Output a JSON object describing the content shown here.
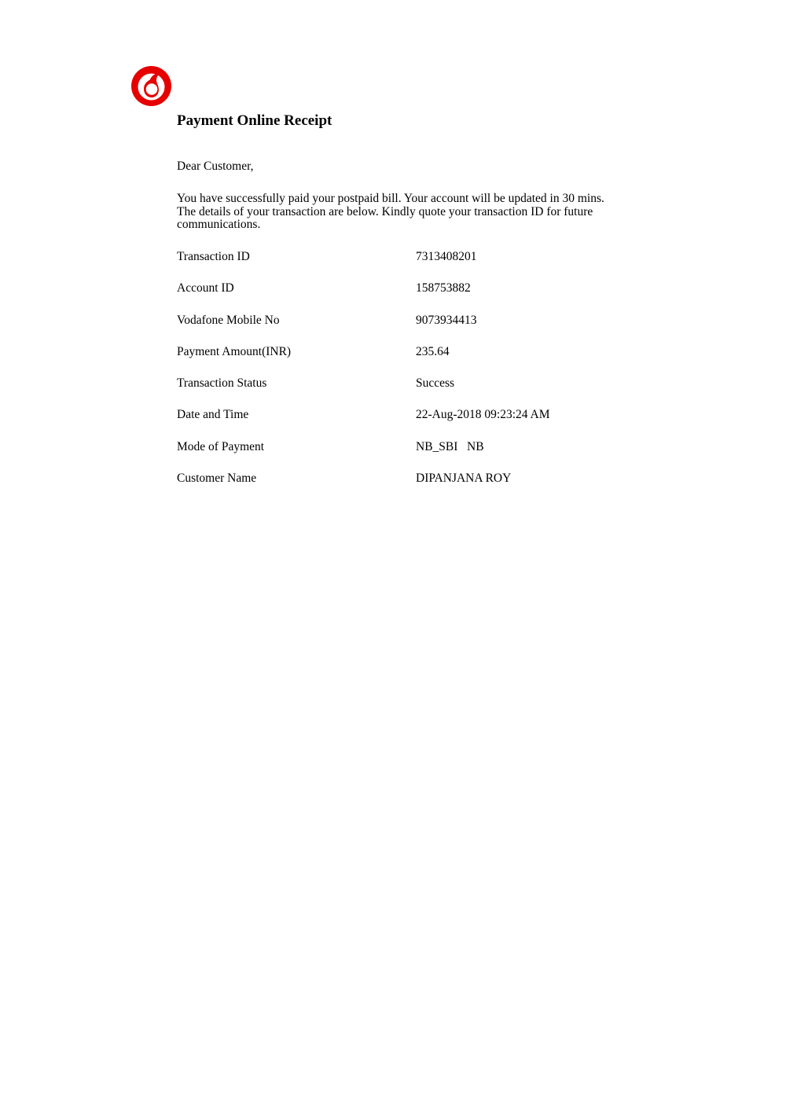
{
  "brand": {
    "logo_icon": "vodafone-speechmark-logo",
    "color": "#e60000"
  },
  "receipt": {
    "title": "Payment Online Receipt",
    "greeting": "Dear Customer,",
    "intro_lines": [
      "You have successfully paid your postpaid bill. Your account will be updated in 30 mins.",
      "The details of your transaction are below.  Kindly quote your transaction ID for future",
      "communications."
    ],
    "details": [
      {
        "label": "Transaction ID",
        "value": "7313408201"
      },
      {
        "label": "Account ID",
        "value": "158753882"
      },
      {
        "label": "Vodafone Mobile No",
        "value": "9073934413"
      },
      {
        "label": "Payment Amount(INR)",
        "value": "235.64"
      },
      {
        "label": "Transaction Status",
        "value": "Success"
      },
      {
        "label": "Date and Time",
        "value": "22-Aug-2018 09:23:24 AM"
      },
      {
        "label": "Mode of Payment",
        "value": "NB_SBI   NB"
      },
      {
        "label": "Customer Name",
        "value": "DIPANJANA ROY"
      }
    ]
  }
}
